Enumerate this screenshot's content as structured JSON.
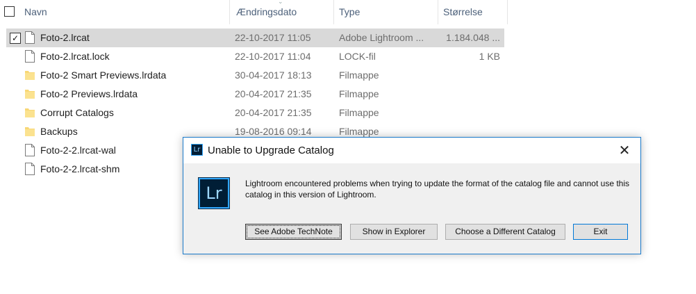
{
  "header": {
    "col_name": "Navn",
    "col_date": "Ændringsdato",
    "col_type": "Type",
    "col_size": "Størrelse"
  },
  "files": [
    {
      "name": "Foto-2.lrcat",
      "date": "22-10-2017 11:05",
      "type": "Adobe Lightroom ...",
      "size": "1.184.048 ...",
      "icon": "file-icon",
      "selected": true
    },
    {
      "name": "Foto-2.lrcat.lock",
      "date": "22-10-2017 11:04",
      "type": "LOCK-fil",
      "size": "1 KB",
      "icon": "file-icon"
    },
    {
      "name": "Foto-2 Smart Previews.lrdata",
      "date": "30-04-2017 18:13",
      "type": "Filmappe",
      "size": "",
      "icon": "folder-icon"
    },
    {
      "name": "Foto-2 Previews.lrdata",
      "date": "20-04-2017 21:35",
      "type": "Filmappe",
      "size": "",
      "icon": "folder-icon"
    },
    {
      "name": "Corrupt Catalogs",
      "date": "20-04-2017 21:35",
      "type": "Filmappe",
      "size": "",
      "icon": "folder-icon"
    },
    {
      "name": "Backups",
      "date": "19-08-2016 09:14",
      "type": "Filmappe",
      "size": "",
      "icon": "folder-icon"
    },
    {
      "name": "Foto-2-2.lrcat-wal",
      "date": "",
      "type": "",
      "size": "",
      "icon": "file-icon"
    },
    {
      "name": "Foto-2-2.lrcat-shm",
      "date": "",
      "type": "",
      "size": "",
      "icon": "file-icon"
    }
  ],
  "dialog": {
    "title": "Unable to Upgrade Catalog",
    "app_icon_text": "Lr",
    "message": "Lightroom encountered problems when trying to update the format of the catalog file and cannot use this catalog in this version of Lightroom.",
    "buttons": {
      "technote": "See Adobe TechNote",
      "explorer": "Show in Explorer",
      "choose": "Choose a Different Catalog",
      "exit": "Exit"
    },
    "close_glyph": "✕"
  },
  "colors": {
    "selection": "#d9d9d9",
    "folder": "#f8d775",
    "dialog_border": "#1979ca",
    "lightroom_bg": "#001e36",
    "lightroom_accent": "#31a8ff"
  }
}
